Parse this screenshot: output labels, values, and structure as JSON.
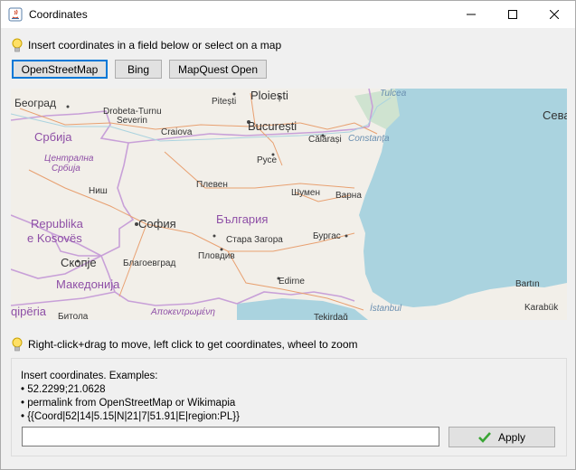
{
  "window": {
    "title": "Coordinates"
  },
  "hints": {
    "top": "Insert coordinates in a field below or select on a map",
    "bottom": "Right-click+drag to move, left click to get coordinates, wheel to zoom"
  },
  "map_sources": [
    {
      "label": "OpenStreetMap",
      "selected": true
    },
    {
      "label": "Bing",
      "selected": false
    },
    {
      "label": "MapQuest Open",
      "selected": false
    }
  ],
  "map": {
    "labels": {
      "beograd": "Београд",
      "drobeta": "Drobeta-Turnu",
      "severin": "Severin",
      "pitesti": "Pitești",
      "ploiesti": "Ploiești",
      "tulcea": "Tulcea",
      "seva": "Сева",
      "srbija": "Србија",
      "craiova": "Craiova",
      "bucuresti": "București",
      "calarasi": "Călărași",
      "constanta": "Constanța",
      "centralna": "Централна",
      "srbija2": "Србија",
      "ruse": "Русе",
      "nis": "Ниш",
      "pleven": "Плевен",
      "shumen": "Шумен",
      "varna": "Варна",
      "republika": "Republika",
      "ekosoves": "e Kosovës",
      "sofia": "София",
      "bulgaria": "България",
      "burgas": "Бургас",
      "stara_zagora": "Стара Загора",
      "skopje": "Скопје",
      "blagoevgrad": "Благоевград",
      "plovdiv": "Пловдив",
      "makedonija": "Македонија",
      "bartin": "Bartın",
      "edirne": "Edirne",
      "qiperia": "qipëria",
      "bitola": "Битола",
      "apokentrimeni": "Αποκεντρωμένη",
      "istanbul": "İstanbul",
      "tekirdag": "Tekirdağ",
      "karabuk": "Karabük"
    },
    "colors": {
      "land": "#f2efe9",
      "sea": "#aad3df",
      "border": "#c8a0d8",
      "road": "#e8a070",
      "water_label": "#6a8fb0",
      "country_label": "#8e4fa6"
    }
  },
  "panel": {
    "intro": "Insert coordinates. Examples:",
    "examples": [
      "• 52.2299;21.0628",
      "• permalink from OpenStreetMap or Wikimapia",
      "• {{Coord|52|14|5.15|N|21|7|51.91|E|region:PL}}"
    ],
    "input_value": "",
    "apply_label": "Apply"
  }
}
